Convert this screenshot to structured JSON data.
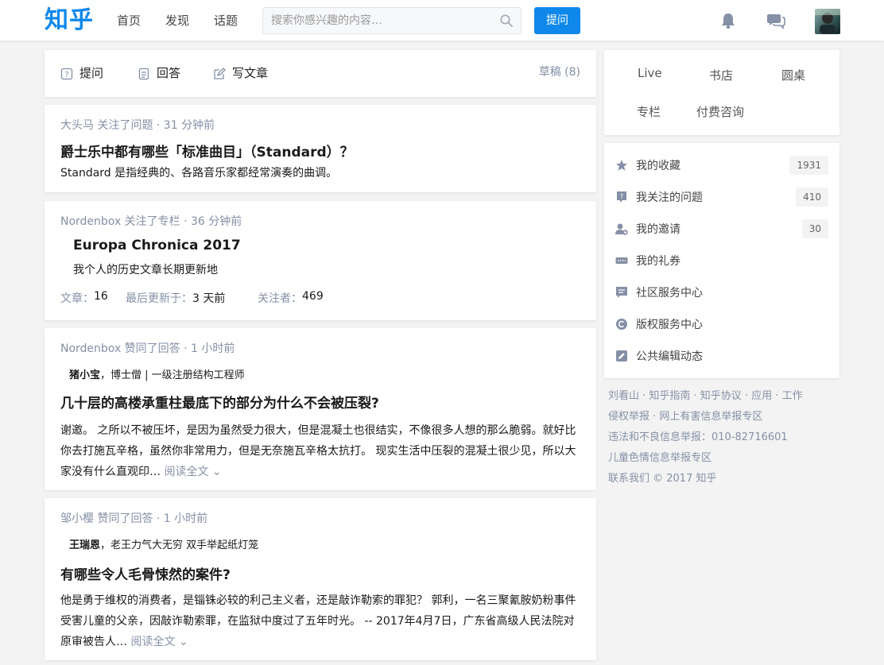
{
  "header": {
    "logo": "知乎",
    "nav": [
      "首页",
      "发现",
      "话题"
    ],
    "search_placeholder": "搜索你感兴趣的内容…",
    "ask_button": "提问",
    "accent": "#0f88eb"
  },
  "composer": {
    "ask": "提问",
    "answer": "回答",
    "write": "写文章",
    "drafts": "草稿 (8)"
  },
  "feed": [
    {
      "meta": "大头马 关注了问题 · 31 分钟前",
      "title": "爵士乐中都有哪些「标准曲目」（Standard）？",
      "text": "Standard 是指经典的、各路音乐家都经常演奏的曲调。"
    },
    {
      "meta": "Nordenbox 关注了专栏 · 36 分钟前",
      "title": "Europa Chronica 2017",
      "text": "我个人的历史文章长期更新地",
      "stats": {
        "articles_label": "文章：",
        "articles": "16",
        "updated_label": "最后更新于：",
        "updated": "3 天前",
        "followers_label": "关注者：",
        "followers": "469"
      }
    },
    {
      "meta": "Nordenbox 赞同了回答 · 1 小时前",
      "author_name": "猪小宝",
      "author_bio": "，博士僧 | 一级注册结构工程师",
      "title": "几十层的高楼承重柱最底下的部分为什么不会被压裂?",
      "text": "谢邀。 之所以不被压坏，是因为虽然受力很大，但是混凝土也很结实，不像很多人想的那么脆弱。就好比你去打施瓦辛格，虽然你非常用力，但是无奈施瓦辛格太抗打。 现实生活中压裂的混凝土很少见，所以大家没有什么直观印…",
      "read_more": "阅读全文 ⌄"
    },
    {
      "meta": "邹小樱 赞同了回答 · 1 小时前",
      "author_name": "王瑞恩",
      "author_bio": "，老王力气大无穷 双手举起纸灯笼",
      "title": "有哪些令人毛骨悚然的案件?",
      "text": "他是勇于维权的消费者，是锱铢必较的利己主义者，还是敲诈勒索的罪犯？ 郭利，一名三聚氰胺奶粉事件受害儿童的父亲，因敲诈勒索罪，在监狱中度过了五年时光。 -- 2017年4月7日，广东省高级人民法院对原审被告人…",
      "read_more": "阅读全文 ⌄"
    }
  ],
  "quick_links": [
    "Live",
    "书店",
    "圆桌",
    "专栏",
    "付费咨询"
  ],
  "side_list": [
    {
      "label": "我的收藏",
      "count": "1931",
      "icon": "star-icon"
    },
    {
      "label": "我关注的问题",
      "count": "410",
      "icon": "question-icon"
    },
    {
      "label": "我的邀请",
      "count": "30",
      "icon": "invite-icon"
    },
    {
      "label": "我的礼券",
      "count": "",
      "icon": "coupon-icon"
    },
    {
      "label": "社区服务中心",
      "count": "",
      "icon": "service-icon"
    },
    {
      "label": "版权服务中心",
      "count": "",
      "icon": "copyright-icon"
    },
    {
      "label": "公共编辑动态",
      "count": "",
      "icon": "edit-icon"
    }
  ],
  "footer": {
    "line1": "刘看山 · 知乎指南 · 知乎协议 · 应用 · 工作",
    "line2": "侵权举报 · 网上有害信息举报专区",
    "line3": "违法和不良信息举报：010-82716601",
    "line4": "儿童色情信息举报专区",
    "line5": "联系我们 © 2017 知乎"
  }
}
